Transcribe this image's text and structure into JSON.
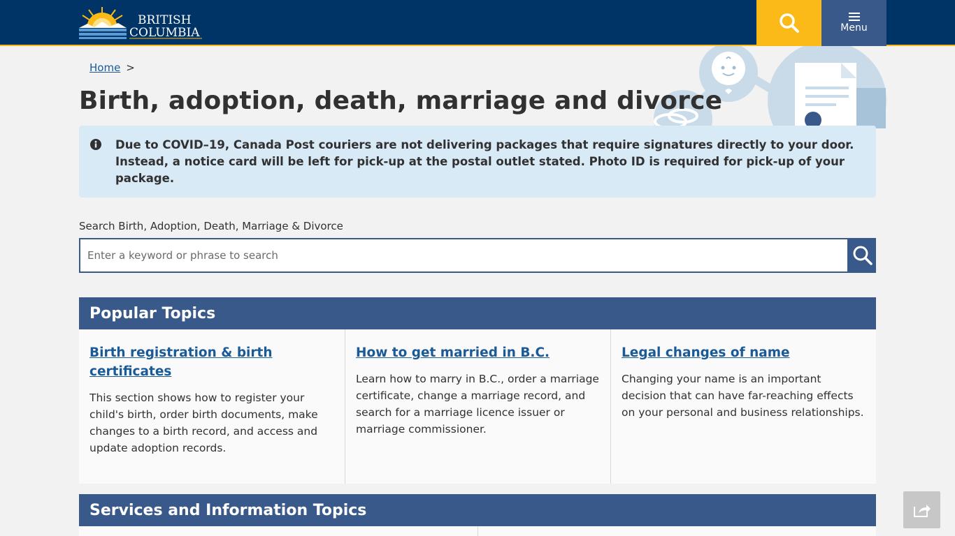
{
  "header": {
    "logo": {
      "line1": "BRITISH",
      "line2": "COLUMBIA"
    },
    "search_icon": "search-icon",
    "menu_label": "Menu"
  },
  "breadcrumb": {
    "home_label": "Home",
    "separator": ">"
  },
  "page_title": "Birth, adoption, death, marriage and divorce",
  "alert": {
    "icon": "info-icon",
    "text": "Due to COVID–19, Canada Post couriers are not delivering packages that require signatures directly to your door. Instead, a notice card will be left for pick-up at the postal outlet stated. Photo ID is required for pick-up of your package."
  },
  "search": {
    "label": "Search Birth, Adoption, Death, Marriage & Divorce",
    "placeholder": "Enter a keyword or phrase to search",
    "value": ""
  },
  "popular_topics": {
    "heading": "Popular Topics",
    "cards": [
      {
        "title": "Birth registration & birth certificates",
        "description": "This section shows how to register your child's birth, order birth documents, make changes to a birth record, and access and update adoption records."
      },
      {
        "title": "How to get married in B.C.",
        "description": "Learn how to marry in B.C., order a marriage certificate, change a marriage record, and search for a marriage licence issuer or marriage commissioner."
      },
      {
        "title": "Legal changes of name",
        "description": "Changing your name is an important decision that can have far-reaching effects on your personal and business relationships."
      }
    ]
  },
  "services_topics": {
    "heading": "Services and Information Topics"
  },
  "share_icon": "share-icon",
  "colors": {
    "header_bg": "#003366",
    "accent_gold": "#fcba19",
    "panel_blue": "#38598a",
    "link_blue": "#1a5a96",
    "alert_bg": "#d9eaf7",
    "page_bg": "#f2f2f2"
  }
}
